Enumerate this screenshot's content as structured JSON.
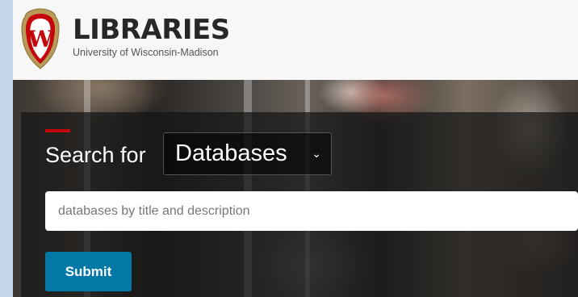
{
  "brand": {
    "title": "LIBRARIES",
    "subtitle": "University of Wisconsin-Madison",
    "crest_letter": "W",
    "crest_icon": "uw-crest-icon",
    "colors": {
      "crest_red": "#c5050c",
      "crest_gold": "#b89a57",
      "title": "#282728"
    }
  },
  "search": {
    "label": "Search for",
    "type_selected": "Databases",
    "type_chevron_icon": "chevron-down-icon",
    "placeholder": "databases by title and description",
    "value": "",
    "submit_label": "Submit",
    "colors": {
      "accent": "#c5050c",
      "submit": "#0479a8"
    }
  }
}
